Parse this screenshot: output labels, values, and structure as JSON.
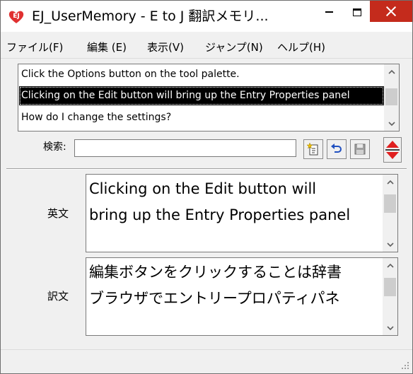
{
  "window": {
    "title": "EJ_UserMemory - E to J 翻訳メモリ...",
    "icon": "ej-app-icon",
    "controls": {
      "minimize": "minimize-icon",
      "maximize": "maximize-icon",
      "close": "close-icon"
    },
    "colors": {
      "close_button": "#c42b1c",
      "selection": "#000000",
      "arrow_red": "#e02020"
    }
  },
  "menu": [
    {
      "label": "ファイル(F)"
    },
    {
      "label": "編集 (E)"
    },
    {
      "label": "表示(V)"
    },
    {
      "label": "ジャンプ(N)"
    },
    {
      "label": "ヘルプ(H)"
    }
  ],
  "results": {
    "rows": [
      {
        "text": "Click the Options button on the tool palette."
      },
      {
        "text": "Clicking on the Edit button will bring up the Entry Properties panel"
      },
      {
        "text": "How do I change the settings?"
      }
    ],
    "selected_index": 1
  },
  "search": {
    "label": "検索:",
    "value": "",
    "buttons": {
      "new": "new-entry-icon",
      "undo": "undo-icon",
      "save": "save-icon",
      "nav": "up-down-arrows-icon"
    }
  },
  "source": {
    "label": "英文",
    "lines": [
      "Clicking on the Edit button will",
      "bring up the Entry Properties panel"
    ]
  },
  "target": {
    "label": "訳文",
    "lines": [
      "編集ボタンをクリックすることは辞書",
      "ブラウザでエントリープロパティパネ"
    ]
  }
}
